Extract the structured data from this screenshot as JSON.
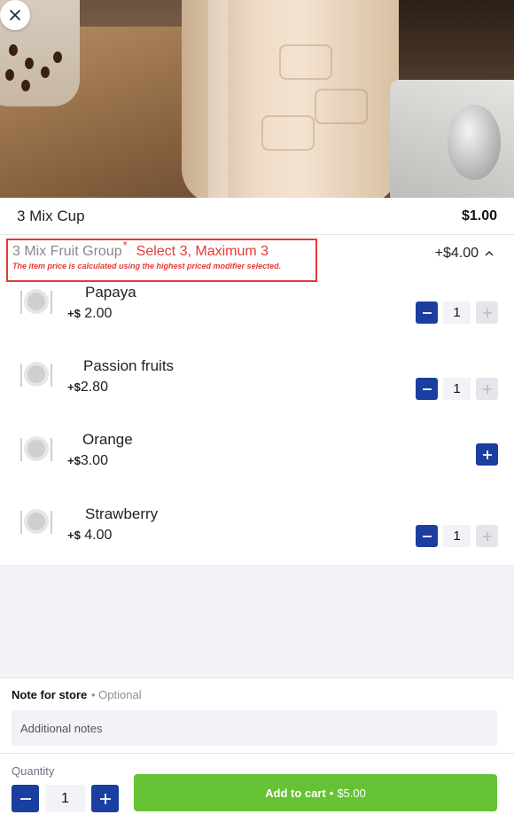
{
  "item": {
    "name": "3 Mix Cup",
    "price": "$1.00"
  },
  "modifier_group": {
    "name": "3 Mix Fruit Group",
    "required_mark": "*",
    "rule": "Select 3, Maximum 3",
    "note": "The item price is calculated using the highest priced modifier selected.",
    "total": "+$4.00"
  },
  "options": [
    {
      "name": "Papaya",
      "price_sym": "+$",
      "price": " 2.00",
      "quantity": "1",
      "selected": true
    },
    {
      "name": "Passion fruits",
      "price_sym": "+$",
      "price": "2.80",
      "quantity": "1",
      "selected": true
    },
    {
      "name": "Orange",
      "price_sym": "+$",
      "price": "3.00",
      "quantity": "0",
      "selected": false
    },
    {
      "name": "Strawberry",
      "price_sym": "+$",
      "price": " 4.00",
      "quantity": "1",
      "selected": true
    }
  ],
  "note_for_store": {
    "label": "Note for store",
    "optional": "• Optional",
    "placeholder": "Additional notes"
  },
  "footer": {
    "quantity_label": "Quantity",
    "quantity": "1",
    "add_label": "Add to cart",
    "separator": "•",
    "amount": "$5.00"
  },
  "colors": {
    "accent_blue": "#1b3fa0",
    "cart_green": "#66c235",
    "alert_red": "#e53935"
  },
  "icons": {
    "close": "close-icon",
    "collapse": "chevron-up-icon",
    "dish": "plate-cutlery-icon",
    "minus": "minus-icon",
    "plus": "plus-icon"
  }
}
